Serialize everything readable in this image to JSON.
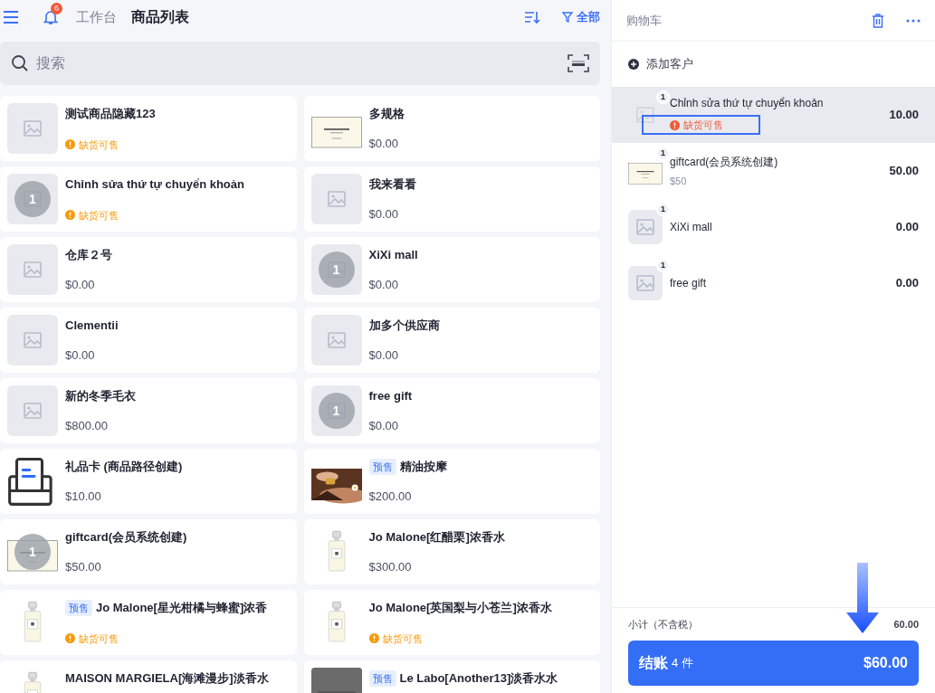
{
  "header": {
    "notification_count": "6",
    "breadcrumb": "工作台",
    "title": "商品列表",
    "filter_label": "全部"
  },
  "search": {
    "placeholder": "搜索"
  },
  "products": [
    {
      "name": "测试商品隐藏123",
      "kind": "placeholder",
      "warning": "缺货可售"
    },
    {
      "name": "多规格",
      "kind": "card",
      "price": "$0.00"
    },
    {
      "name": "Chỉnh sửa thứ tự chuyển khoản",
      "kind": "placeholder",
      "badge": "1",
      "warning": "缺货可售"
    },
    {
      "name": "我来看看",
      "kind": "placeholder",
      "price": "$0.00"
    },
    {
      "name": "仓库２号",
      "kind": "placeholder",
      "price": "$0.00"
    },
    {
      "name": "XiXi mall",
      "kind": "placeholder",
      "badge": "1",
      "price": "$0.00"
    },
    {
      "name": "Clementii",
      "kind": "placeholder",
      "price": "$0.00"
    },
    {
      "name": "加多个供应商",
      "kind": "placeholder",
      "price": "$0.00"
    },
    {
      "name": "新的冬季毛衣",
      "kind": "placeholder",
      "price": "$800.00"
    },
    {
      "name": "free gift",
      "kind": "placeholder",
      "badge": "1",
      "price": "$0.00"
    },
    {
      "name": "礼品卡 (商品路径创建)",
      "kind": "printer",
      "price": "$10.00"
    },
    {
      "name": "精油按摩",
      "tag": "预售",
      "price": "$200.00"
    },
    {
      "name": "giftcard(会员系统创建)",
      "kind": "card",
      "badge": "1",
      "price": "$50.00"
    },
    {
      "name": "Jo Malone[红醋栗]浓香水",
      "kind": "bottle",
      "price": "$300.00"
    },
    {
      "name": "Jo Malone[星光柑橘与蜂蜜]浓香",
      "kind": "bottle",
      "tag": "预售",
      "warning": "缺货可售"
    },
    {
      "name": "Jo Malone[英国梨与小苍兰]浓香水",
      "kind": "bottle",
      "warning": "缺货可售"
    },
    {
      "name": "MAISON MARGIELA[海滩漫步]淡香水",
      "kind": "bottle"
    },
    {
      "name": "Le Labo[Another13]淡香水水",
      "kind": "dark",
      "tag": "预售"
    }
  ],
  "cart": {
    "title": "购物车",
    "add_customer": "添加客户",
    "items": [
      {
        "qty": "1",
        "name": "Chỉnh sửa thứ tự chuyển khoản",
        "kind": "faded",
        "warning": "缺货可售",
        "amount": "10.00",
        "selected": true
      },
      {
        "qty": "1",
        "name": "giftcard(会员系统创建)",
        "kind": "card",
        "note": "$50",
        "amount": "50.00",
        "selected": false
      },
      {
        "qty": "1",
        "name": "XiXi mall",
        "kind": "placeholder",
        "amount": "0.00",
        "selected": false
      },
      {
        "qty": "1",
        "name": "free gift",
        "kind": "placeholder",
        "amount": "0.00",
        "selected": false
      }
    ],
    "subtotal_label": "小计（不含税）",
    "subtotal": "60.00",
    "checkout": {
      "label": "结账",
      "count": "4 件",
      "total": "$60.00"
    }
  }
}
